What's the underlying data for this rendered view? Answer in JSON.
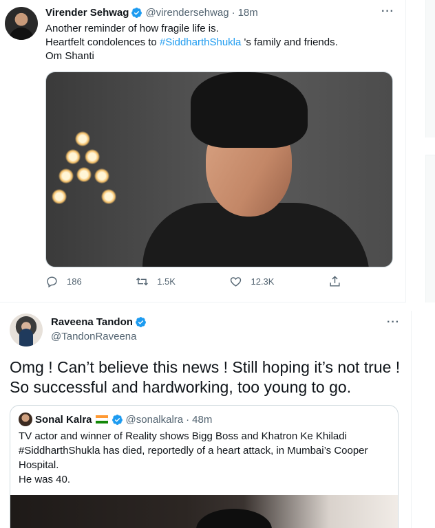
{
  "tweet1": {
    "name": "Virender Sehwag",
    "handle": "@virendersehwag",
    "separator": "·",
    "time": "18m",
    "more": "···",
    "lines": [
      {
        "text": "Another reminder of how fragile life is."
      },
      {
        "before": "Heartfelt condolences to ",
        "hashtag": "#SiddharthShukla",
        "after": " 's family and friends."
      },
      {
        "text": "Om Shanti"
      }
    ],
    "actions": {
      "replies": "186",
      "retweets": "1.5K",
      "likes": "12.3K"
    },
    "icons": [
      "reply-icon",
      "retweet-icon",
      "like-icon",
      "share-icon"
    ]
  },
  "tweet2": {
    "name": "Raveena Tandon",
    "handle": "@TandonRaveena",
    "more": "···",
    "text": "Omg ! Can’t believe this news ! Still hoping it’s not true ! So successful and hardworking, too young to go.",
    "quote": {
      "name": "Sonal Kalra",
      "handle": "@sonalkalra",
      "separator": "·",
      "time": "48m",
      "lines": [
        "TV actor and winner of Reality shows Bigg Boss and Khatron Ke Khiladi",
        "#SiddharthShukla has died, reportedly of a heart attack, in Mumbai’s Cooper",
        "Hospital.",
        "He was 40."
      ]
    }
  },
  "colors": {
    "accent": "#1d9bf0",
    "text": "#0f1419",
    "secondary": "#536471",
    "border": "#cfd9de"
  }
}
